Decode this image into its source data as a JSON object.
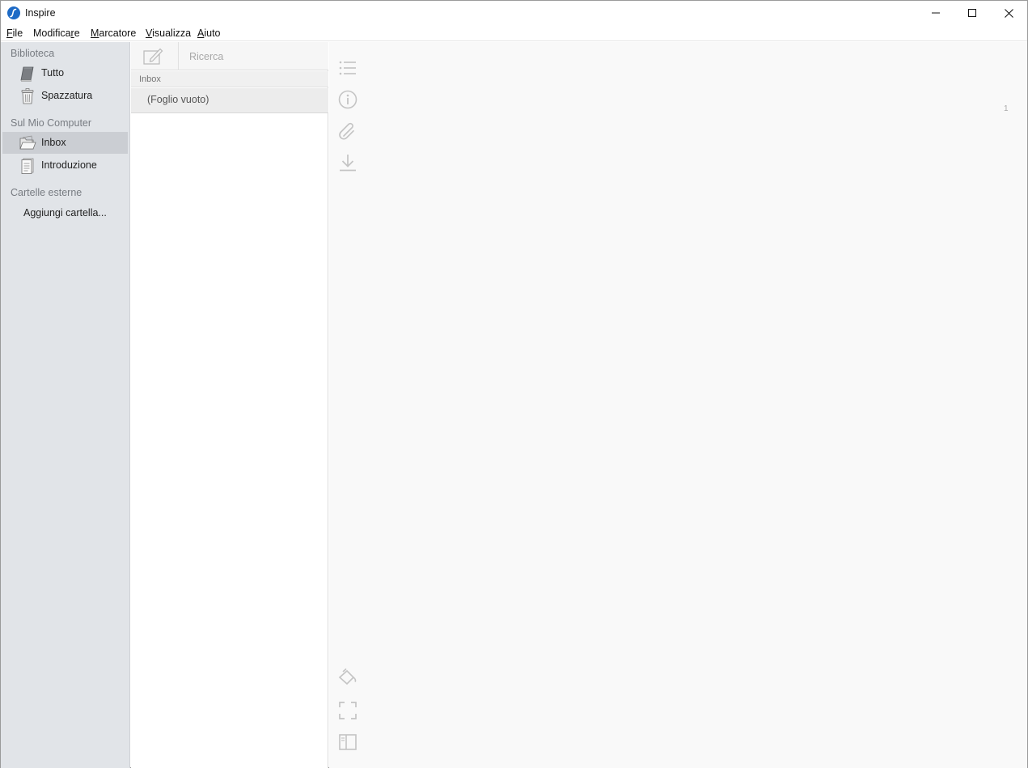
{
  "window": {
    "title": "Inspire",
    "controls": [
      "minimize",
      "maximize",
      "close"
    ]
  },
  "menu": [
    {
      "pre": "",
      "u": "F",
      "post": "ile"
    },
    {
      "pre": "Modifica",
      "u": "r",
      "post": "e"
    },
    {
      "pre": "",
      "u": "M",
      "post": "arcatore"
    },
    {
      "pre": "",
      "u": "V",
      "post": "isualizza"
    },
    {
      "pre": "",
      "u": "A",
      "post": "iuto"
    }
  ],
  "sidebar": {
    "library_section": "Biblioteca",
    "library_items": [
      {
        "label": "Tutto",
        "icon": "book-icon"
      },
      {
        "label": "Spazzatura",
        "icon": "trash-icon"
      }
    ],
    "computer_section": "Sul Mio Computer",
    "computer_items": [
      {
        "label": "Inbox",
        "icon": "open-folder-icon",
        "selected": true
      },
      {
        "label": "Introduzione",
        "icon": "document-icon",
        "selected": false
      }
    ],
    "external_section": "Cartelle esterne",
    "add_folder": "Aggiungi cartella..."
  },
  "list": {
    "search_placeholder": "Ricerca",
    "group_header": "Inbox",
    "sheets": [
      {
        "title": "(Foglio vuoto)"
      }
    ]
  },
  "editor": {
    "word_count": "1",
    "top_tools": [
      "outline-list-icon",
      "info-icon",
      "attachment-icon",
      "download-icon"
    ],
    "bottom_tools": [
      "bucket-icon",
      "fullscreen-icon",
      "split-view-icon"
    ]
  },
  "colors": {
    "accent": "#1e6bc6",
    "sidebar_bg": "#e1e4e8",
    "sidebar_selected": "#cbced3",
    "editor_bg": "#f9f9f9"
  }
}
